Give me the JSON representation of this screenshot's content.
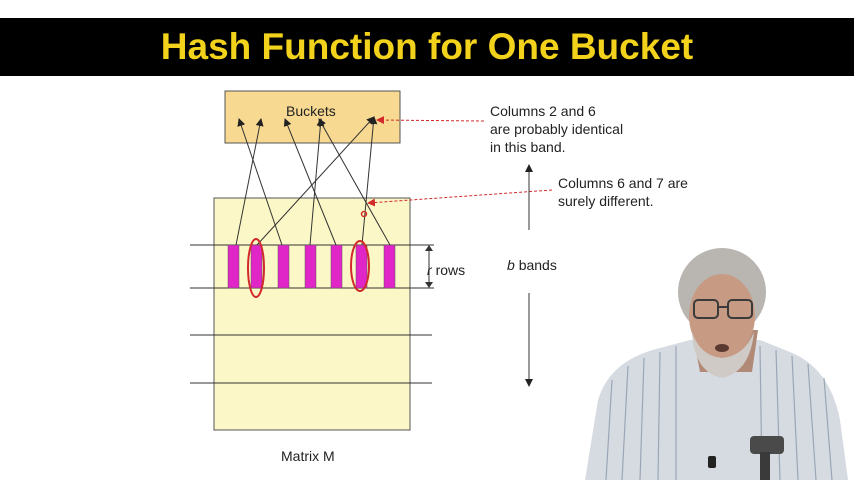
{
  "slide": {
    "title": "Hash Function for One Bucket",
    "buckets_label": "Buckets",
    "note_identical": [
      "Columns 2 and 6",
      "are probably identical",
      "in this band."
    ],
    "note_different": [
      "Columns 6 and 7 are",
      "surely different."
    ],
    "rows_var": "r",
    "rows_word": "rows",
    "bands_var": "b",
    "bands_word": "bands",
    "matrix_label": "Matrix M"
  },
  "colors": {
    "title_text": "#f3d21b",
    "title_bar": "#000000",
    "bucket_fill": "#f7d992",
    "matrix_fill": "#fbf7c6",
    "column_fill": "#e026c7",
    "annotation_red": "#d22a2a"
  },
  "icons": [
    "speaker-photo",
    "microphone-icon"
  ]
}
